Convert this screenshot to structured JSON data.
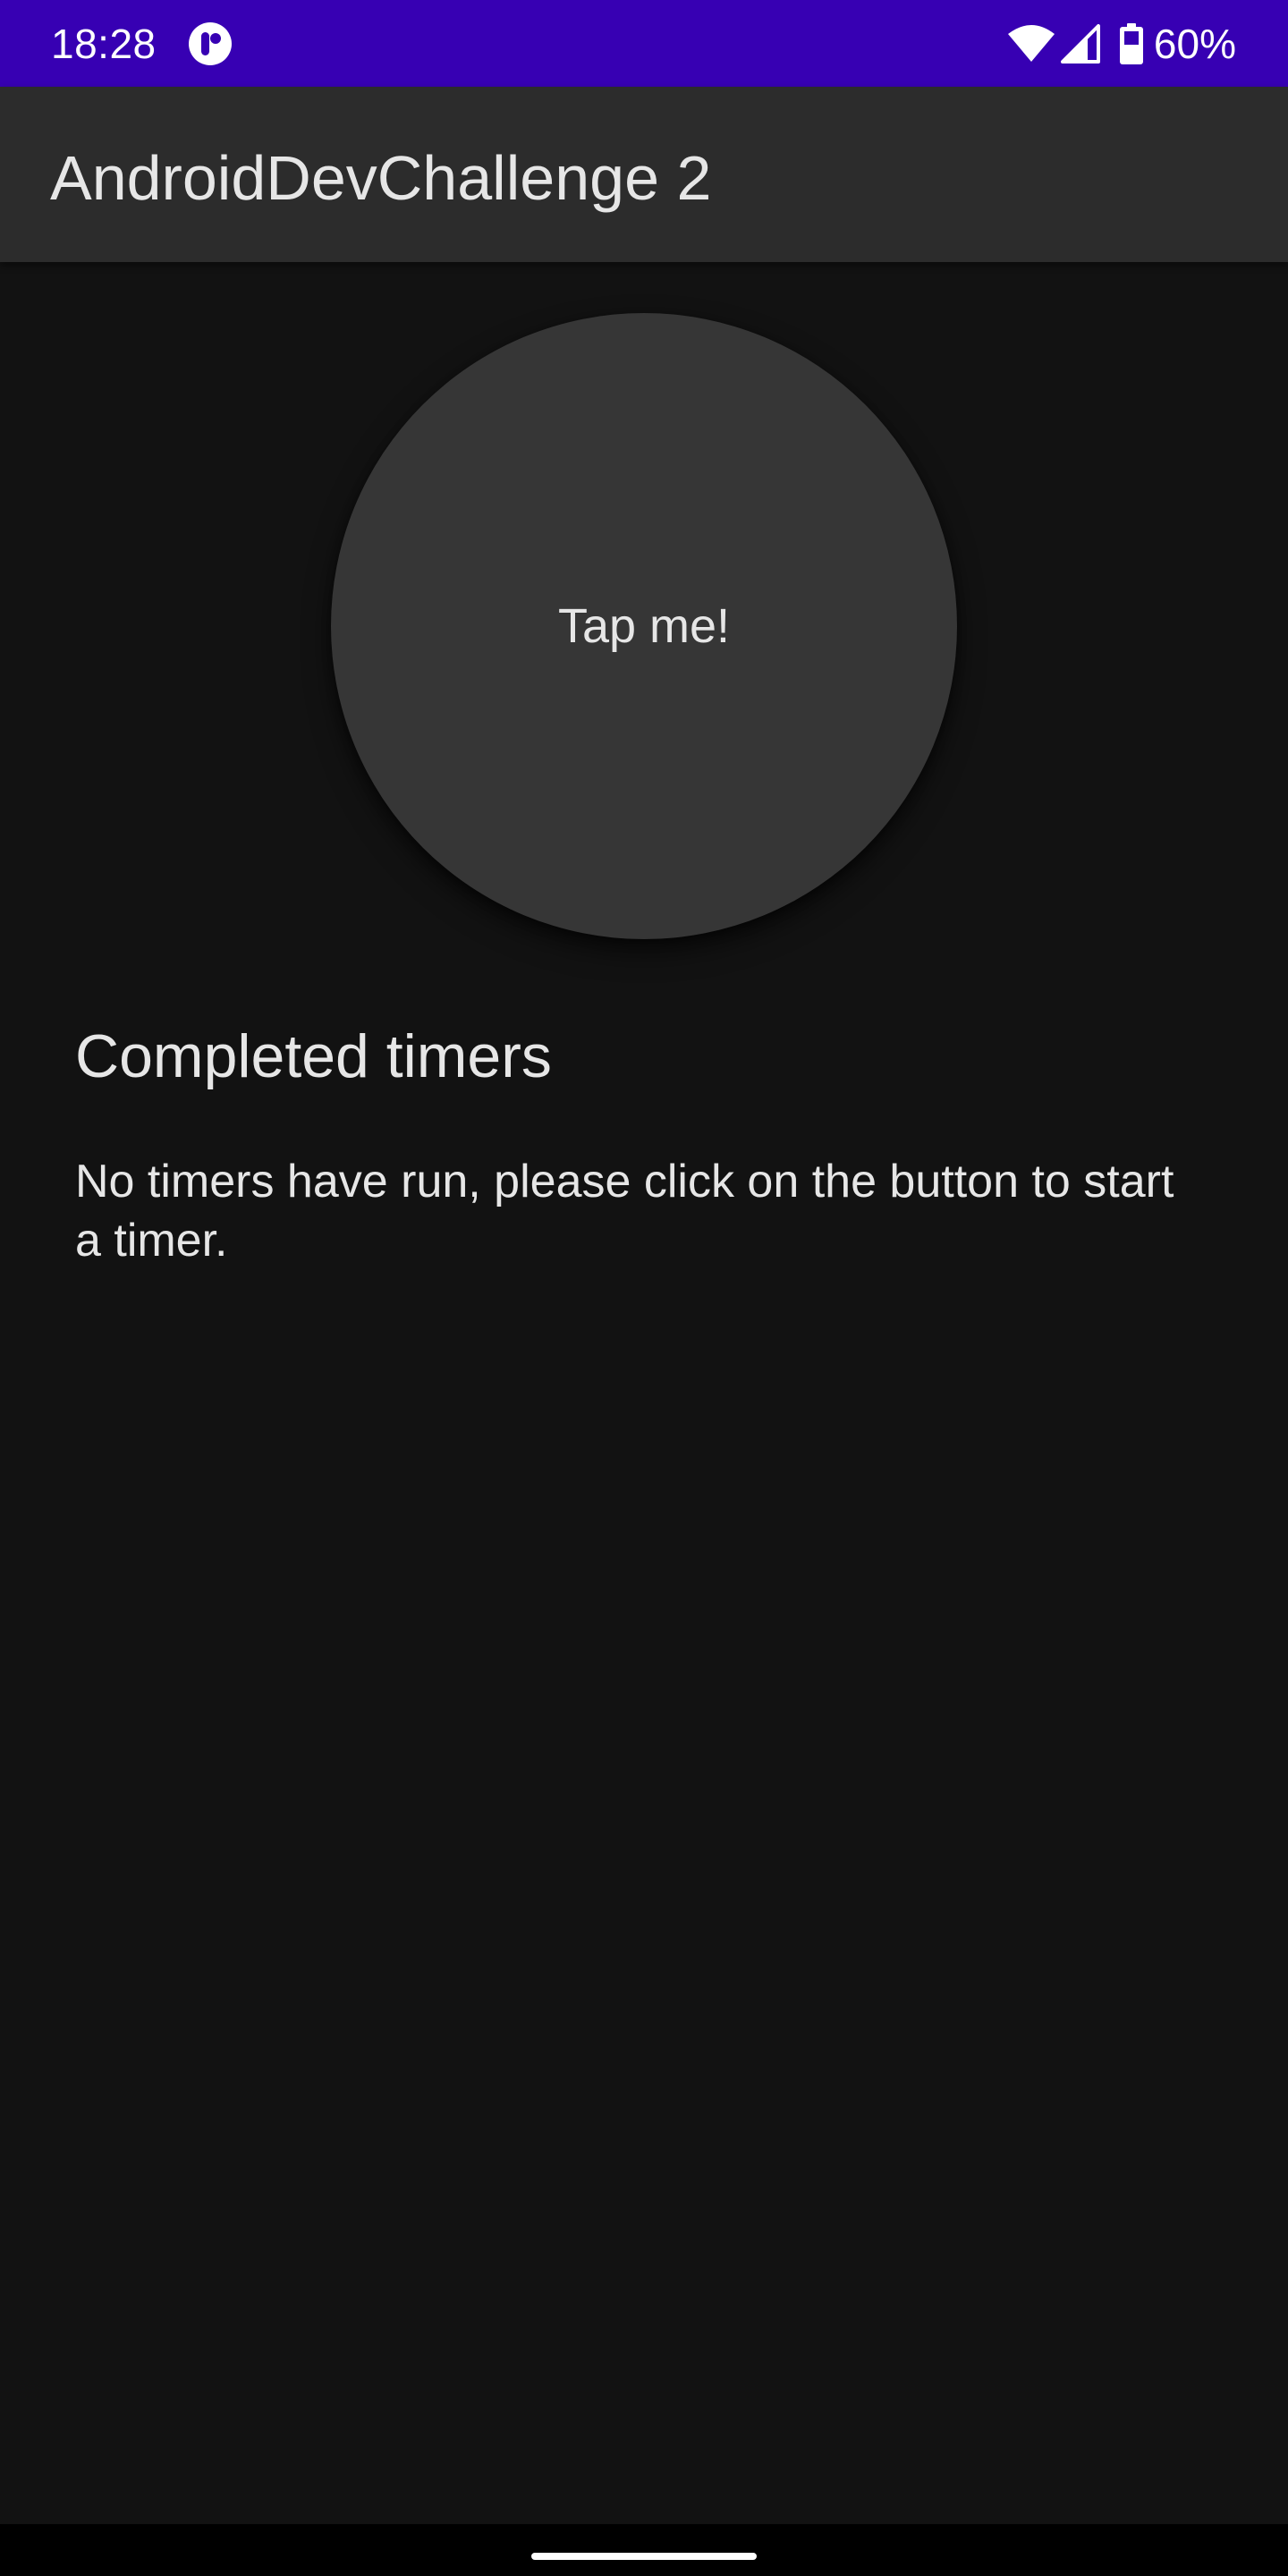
{
  "status_bar": {
    "time": "18:28",
    "battery_percent": "60%",
    "background_color": "#3700B3",
    "icons": [
      "app-notification-icon",
      "wifi-icon",
      "cell-signal-icon",
      "battery-icon"
    ]
  },
  "app_bar": {
    "title": "AndroidDevChallenge 2"
  },
  "main": {
    "tap_button_label": "Tap me!",
    "completed_section": {
      "heading": "Completed timers",
      "empty_message": "No timers have run, please click on the button to start a timer."
    }
  },
  "colors": {
    "background": "#121212",
    "surface": "#2c2c2c",
    "button": "#363636",
    "text": "#e6e6e6"
  }
}
